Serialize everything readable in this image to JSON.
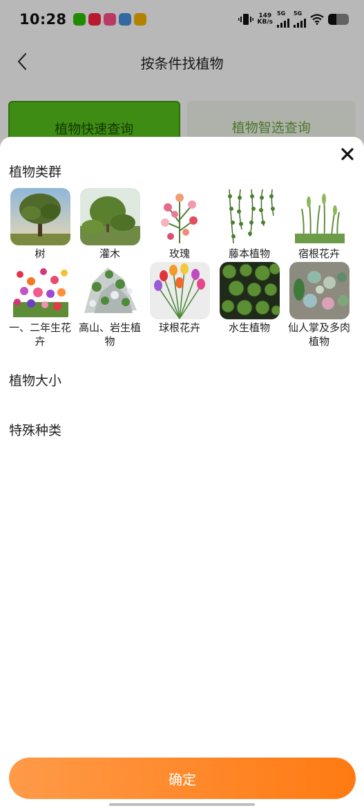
{
  "status_bar": {
    "time": "10:28",
    "net_speed_value": "149",
    "net_speed_unit": "KB/s",
    "sim1_label": "5G",
    "sim2_label": "5G",
    "notification_icons": [
      "wechat-icon",
      "xiaohongshu-icon",
      "app-icon",
      "document-icon",
      "weibo-icon"
    ]
  },
  "nav": {
    "back_icon": "chevron-left-icon",
    "title": "按条件找植物"
  },
  "tabs": [
    {
      "label": "植物快速查询",
      "active": true
    },
    {
      "label": "植物智选查询",
      "active": false
    }
  ],
  "sheet": {
    "close_icon": "close-icon",
    "group_title": "植物类群",
    "categories": [
      {
        "label": "树",
        "icon": "tree-image"
      },
      {
        "label": "灌木",
        "icon": "shrub-image"
      },
      {
        "label": "玫瑰",
        "icon": "rose-image"
      },
      {
        "label": "藤本植物",
        "icon": "vine-image"
      },
      {
        "label": "宿根花卉",
        "icon": "perennial-image"
      },
      {
        "label": "一、二年生花卉",
        "icon": "annual-flower-image"
      },
      {
        "label": "高山、岩生植物",
        "icon": "alpine-plant-image"
      },
      {
        "label": "球根花卉",
        "icon": "bulb-flower-image"
      },
      {
        "label": "水生植物",
        "icon": "aquatic-plant-image"
      },
      {
        "label": "仙人掌及多肉植物",
        "icon": "cactus-image"
      }
    ],
    "size_title": "植物大小",
    "special_title": "特殊种类",
    "confirm_label": "确定"
  },
  "colors": {
    "accent_green": "#57c21b",
    "confirm_gradient_start": "#ff9a48",
    "confirm_gradient_end": "#ff7a12"
  }
}
